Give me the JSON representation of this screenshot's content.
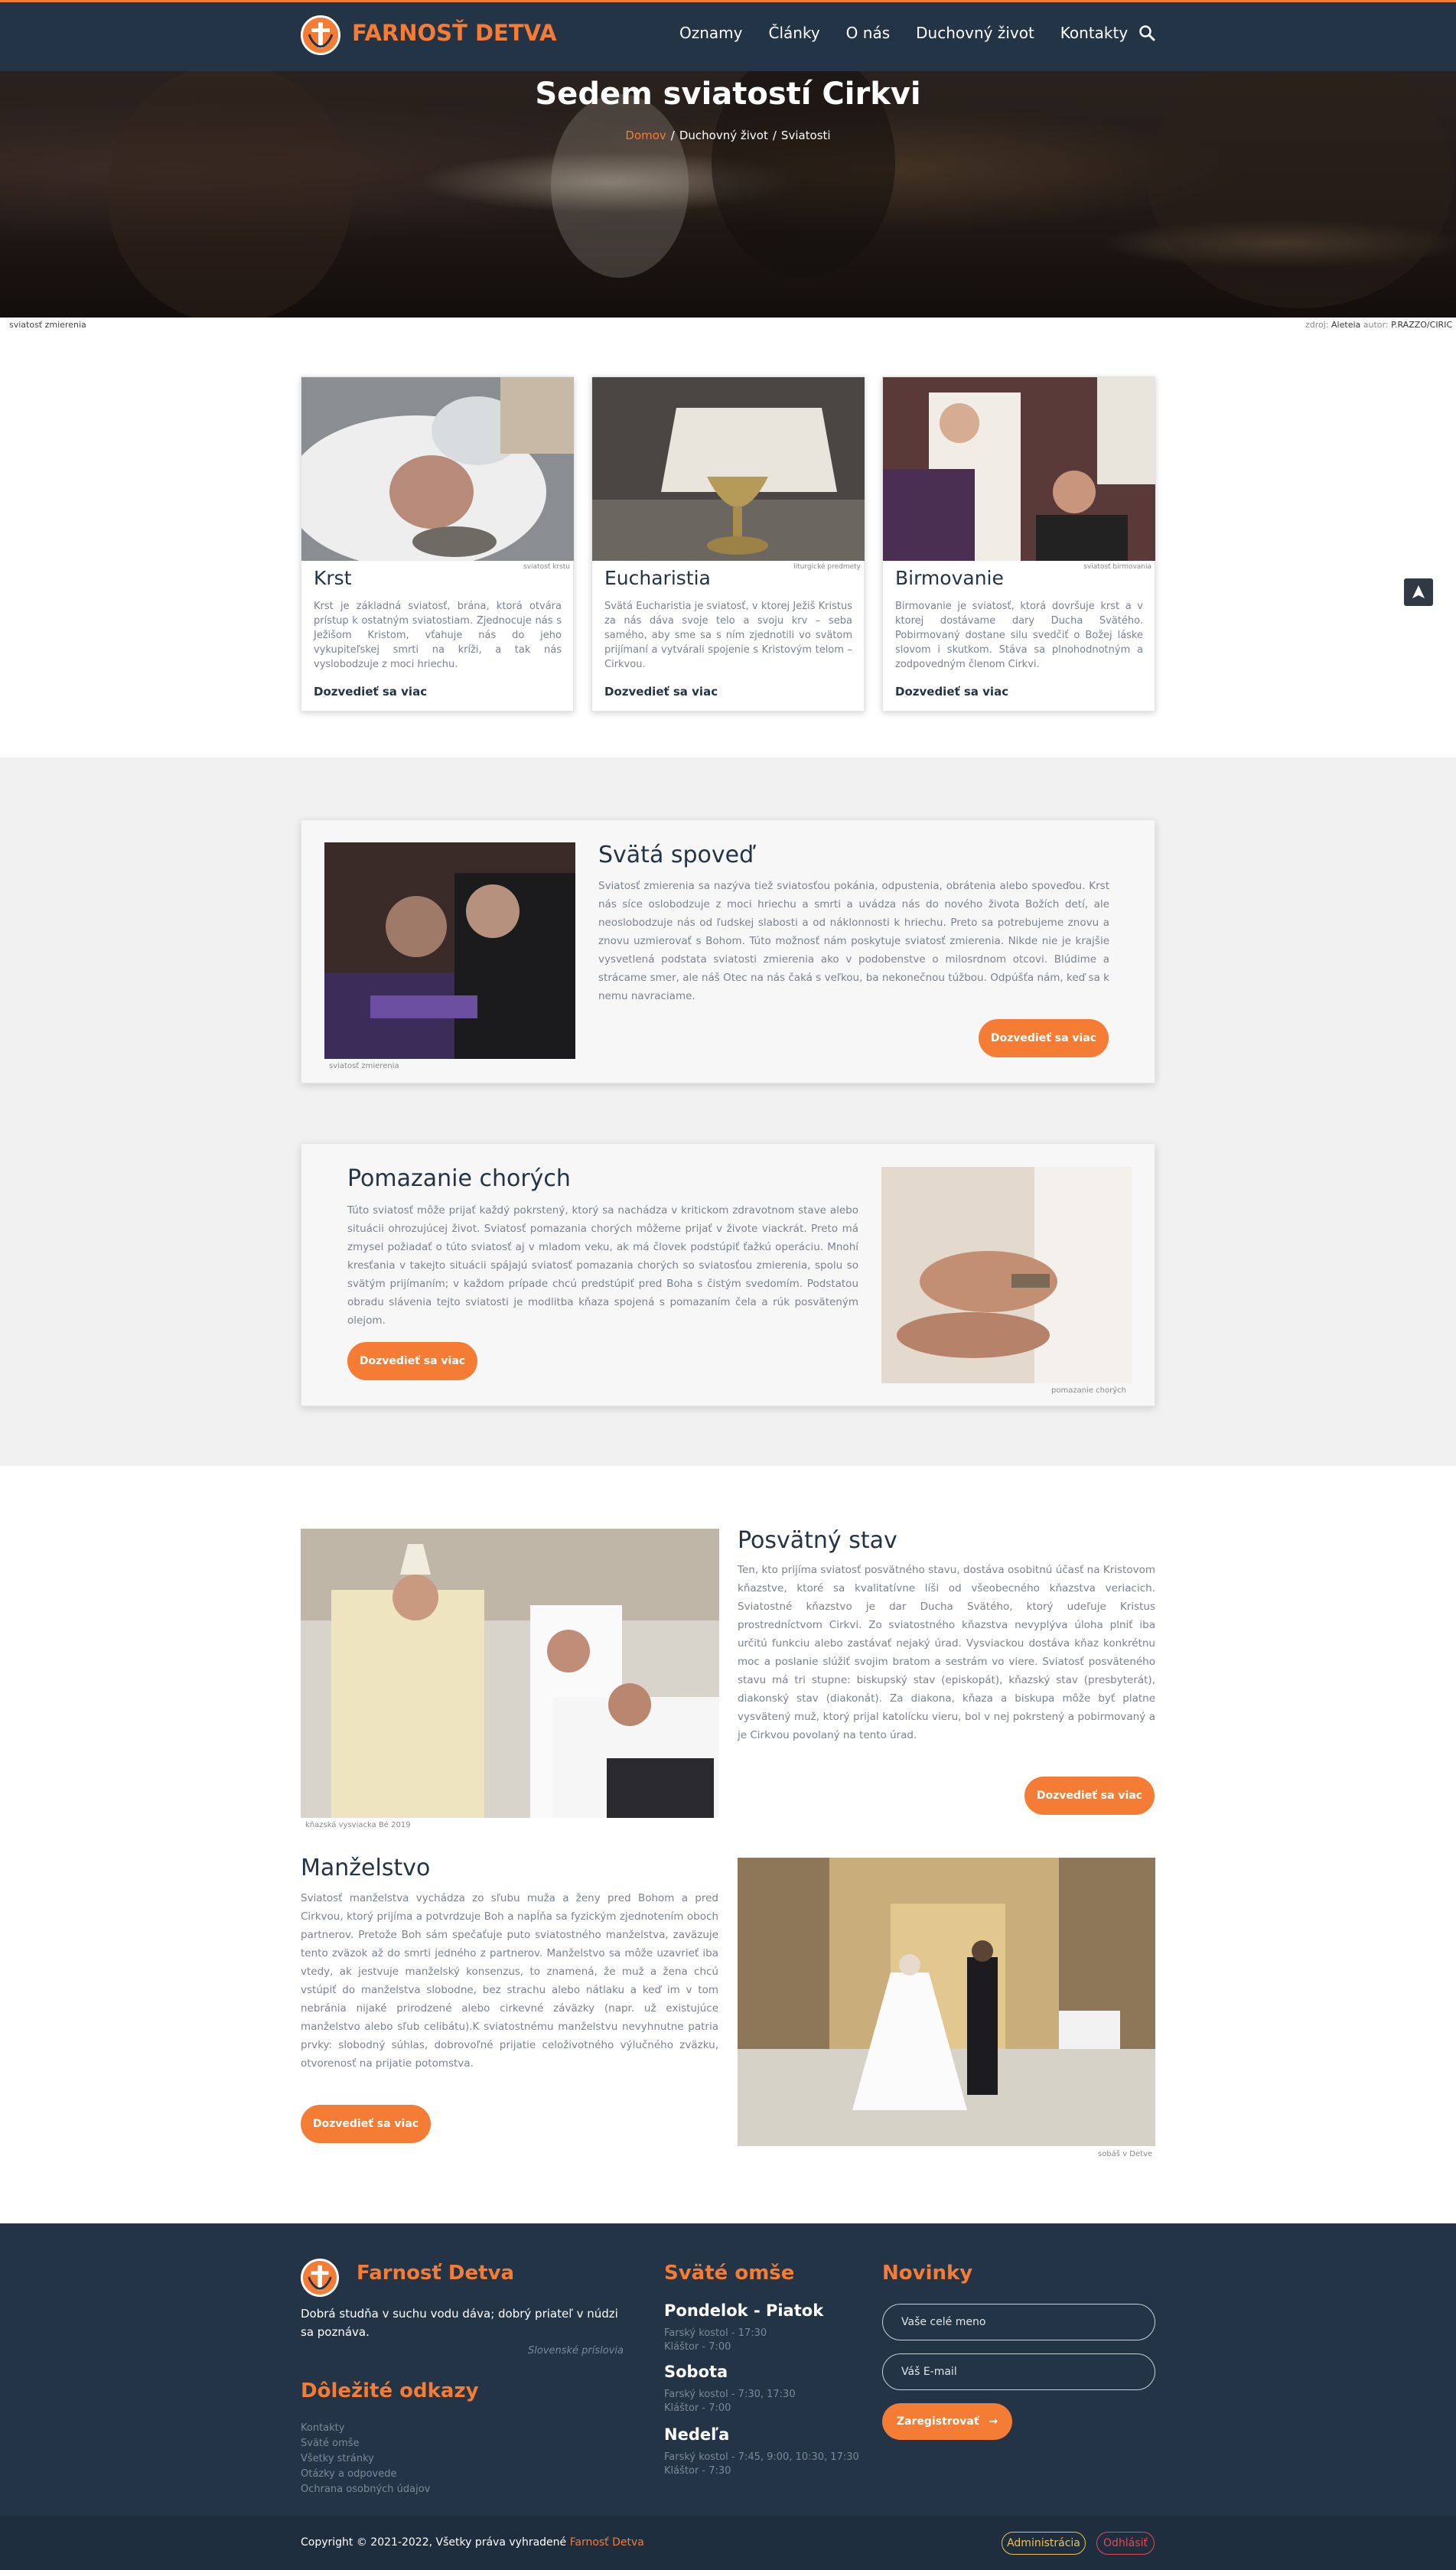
{
  "nav": {
    "brand": "FARNOSŤ DETVA",
    "items": [
      "Oznamy",
      "Články",
      "O nás",
      "Duchovný život",
      "Kontakty"
    ],
    "search_icon": "search-icon"
  },
  "hero": {
    "title": "Sedem sviatostí Cirkvi",
    "breadcrumb": [
      "Domov",
      "Duchovný život",
      "Sviatosti"
    ],
    "caption_left": "sviatosť zmierenia",
    "caption_src_label": "zdroj:",
    "caption_src": "Aleteia",
    "caption_author_label": "autor:",
    "caption_author": "P.RAZZO/CIRIC"
  },
  "cards": [
    {
      "caption": "sviatosť krstu",
      "title": "Krst",
      "text": "Krst je základná sviatosť, brána, ktorá otvára prístup k ostatným sviatostiam. Zjednocuje nás s Ježišom Kristom, vťahuje nás do jeho vykupiteľskej smrti na kríži, a tak nás vyslobodzuje z moci hriechu.",
      "link": "Dozvedieť sa viac"
    },
    {
      "caption": "liturgické predmety",
      "title": "Eucharistia",
      "text": "Svätá Eucharistia je sviatosť, v ktorej Ježiš Kristus za nás dáva svoje telo a svoju krv – seba samého, aby sme sa s ním zjednotili vo svätom prijímaní a vytvárali spojenie s Kristovým telom – Cirkvou.",
      "link": "Dozvedieť sa viac"
    },
    {
      "caption": "sviatosť birmovania",
      "title": "Birmovanie",
      "text": "Birmovanie je sviatosť, ktorá dovršuje krst a v ktorej dostávame dary Ducha Svätého. Pobirmovaný dostane silu svedčiť o Božej láske slovom i skutkom. Stáva sa plnohodnotným a zodpovedným členom Cirkvi.",
      "link": "Dozvedieť sa viac"
    }
  ],
  "spoved": {
    "title": "Svätá spoveď",
    "text": "Sviatosť zmierenia sa nazýva tiež sviatosťou pokánia, odpustenia, obrátenia alebo spoveďou. Krst nás síce oslobodzuje z moci hriechu a smrti a uvádza nás do nového života Božích detí, ale neoslobodzuje nás od ľudskej slabosti a od náklonnosti k hriechu. Preto sa potrebujeme znovu a znovu uzmierovať s Bohom. Túto možnosť nám poskytuje sviatosť zmierenia. Nikde nie je krajšie vysvetlená podstata sviatosti zmierenia ako v podobenstve o milosrdnom otcovi. Blúdime a strácame smer, ale náš Otec na nás čaká s veľkou, ba nekonečnou túžbou. Odpúšťa nám, keď sa k nemu navraciame.",
    "button": "Dozvedieť sa viac",
    "caption": "sviatosť zmierenia"
  },
  "pomazanie": {
    "title": "Pomazanie chorých",
    "text": "Túto sviatosť môže prijať každý pokrstený, ktorý sa nachádza v kritickom zdravotnom stave alebo situácii ohrozujúcej život. Sviatosť pomazania chorých môžeme prijať v živote viackrát. Preto má zmysel požiadať o túto sviatosť aj v mladom veku, ak má človek podstúpiť ťažkú operáciu. Mnohí kresťania v takejto situácii spájajú sviatosť pomazania chorých so sviatosťou zmierenia, spolu so svätým prijímaním; v každom prípade chcú predstúpiť pred Boha s čistým svedomím. Podstatou obradu slávenia tejto sviatosti je modlitba kňaza spojená s pomazaním čela a rúk posväteným olejom.",
    "button": "Dozvedieť sa viac",
    "caption": "pomazanie chorých"
  },
  "posvatny": {
    "title": "Posvätný stav",
    "text": "Ten, kto prijíma sviatosť posvätného stavu, dostáva osobitnú účasť na Kristovom kňazstve, ktoré sa kvalitatívne líši od všeobecného kňazstva veriacich. Sviatostné kňazstvo je dar Ducha Svätého, ktorý udeľuje Kristus prostredníctvom Cirkvi. Zo sviatostného kňazstva nevyplýva úloha plniť iba určitú funkciu alebo zastávať nejaký úrad. Vysviackou dostáva kňaz konkrétnu moc a poslanie slúžiť svojim bratom a sestrám vo viere. Sviatosť posväteného stavu má tri stupne: biskupský stav (episkopát), kňazský stav (presbyterát), diakonský stav (diakonát). Za diakona, kňaza a biskupa môže byť platne vysvätený muž, ktorý prijal katolícku vieru, bol v nej pokrstený a pobirmovaný a je Cirkvou povolaný na tento úrad.",
    "button": "Dozvedieť sa viac",
    "caption": "kňazská vysviacka Bé 2019"
  },
  "manzelstvo": {
    "title": "Manželstvo",
    "text": "Sviatosť manželstva vychádza zo sľubu muža a ženy pred Bohom a pred Cirkvou, ktorý prijíma a potvrdzuje Boh a napĺňa sa fyzickým zjednotením oboch partnerov. Pretože Boh sám spečaťuje puto sviatostného manželstva, zaväzuje tento zväzok až do smrti jedného z partnerov. Manželstvo sa môže uzavrieť iba vtedy, ak jestvuje manželský konsenzus, to znamená, že muž a žena chcú vstúpiť do manželstva slobodne, bez strachu alebo nátlaku a keď im v tom nebránia nijaké prirodzené alebo cirkevné záväzky (napr. už existujúce manželstvo alebo sľub celibátu).K sviatostnému manželstvu nevyhnutne patria prvky: slobodný súhlas, dobrovoľné prijatie celoživotného výlučného zväzku, otvorenosť na prijatie potomstva.",
    "button": "Dozvedieť sa viac",
    "caption": "sobáš v Detve"
  },
  "footer": {
    "brand": "Farnosť Detva",
    "quote": "Dobrá studňa v suchu vodu dáva; dobrý priateľ v núdzi sa poznáva.",
    "quote_src": "Slovenské príslovia",
    "links_title": "Dôležité odkazy",
    "links": [
      "Kontakty",
      "Sväté omše",
      "Všetky stránky",
      "Otázky a odpovede",
      "Ochrana osobných údajov"
    ],
    "mass_title": "Sväté omše",
    "mass": [
      {
        "day": "Pondelok - Piatok",
        "lines": [
          "Farský kostol - 17:30",
          "Kláštor - 7:00"
        ]
      },
      {
        "day": "Sobota",
        "lines": [
          "Farský kostol - 7:30, 17:30",
          "Kláštor - 7:00"
        ]
      },
      {
        "day": "Nedeľa",
        "lines": [
          "Farský kostol - 7:45, 9:00, 10:30, 17:30",
          "Kláštor - 7:30"
        ]
      }
    ],
    "news_title": "Novinky",
    "name_placeholder": "Vaše celé meno",
    "email_placeholder": "Váš E-mail",
    "subscribe": "Zaregistrovať",
    "copyright": "Copyright © 2021-2022, Všetky práva vyhradené",
    "copyright_brand": "Farnosť Detva",
    "admin": "Administrácia",
    "logout": "Odhlásiť"
  },
  "colors": {
    "accent": "#f47c34",
    "navy": "#233447",
    "text_muted": "#7a8290"
  }
}
